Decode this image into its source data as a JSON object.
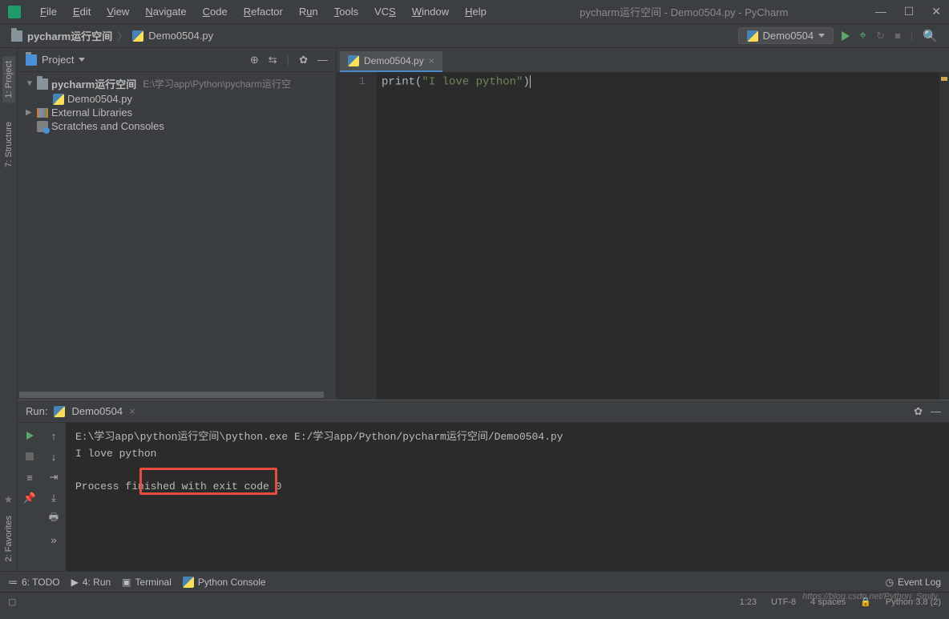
{
  "menu": [
    "File",
    "Edit",
    "View",
    "Navigate",
    "Code",
    "Refactor",
    "Run",
    "Tools",
    "VCS",
    "Window",
    "Help"
  ],
  "title": "pycharm运行空间 - Demo0504.py - PyCharm",
  "breadcrumb": {
    "project": "pycharm运行空间",
    "file": "Demo0504.py"
  },
  "runConfig": "Demo0504",
  "projectPanel": {
    "title": "Project",
    "root": "pycharm运行空间",
    "rootPath": "E:\\学习app\\Python\\pycharm运行空",
    "file": "Demo0504.py",
    "external": "External Libraries",
    "scratches": "Scratches and Consoles"
  },
  "editor": {
    "tab": "Demo0504.py",
    "lineNum": "1",
    "code": {
      "fn": "print",
      "open": "(",
      "str": "\"I love python\"",
      "close": ")"
    }
  },
  "run": {
    "label": "Run:",
    "tab": "Demo0504",
    "cmd": "E:\\学习app\\python运行空间\\python.exe E:/学习app/Python/pycharm运行空间/Demo0504.py",
    "output": "I love python",
    "exit": "Process finished with exit code 0"
  },
  "bottom": {
    "todo": "6: TODO",
    "run": "4: Run",
    "terminal": "Terminal",
    "pyconsole": "Python Console",
    "eventlog": "Event Log"
  },
  "status": {
    "pos": "1:23",
    "enc": "UTF-8",
    "indent": "4 spaces",
    "python": "Python 3.8 (2)"
  },
  "sideTabs": {
    "project": "1: Project",
    "structure": "7: Structure",
    "favorites": "2: Favorites"
  },
  "watermark": "https://blog.csdn.net/Python_Smily"
}
